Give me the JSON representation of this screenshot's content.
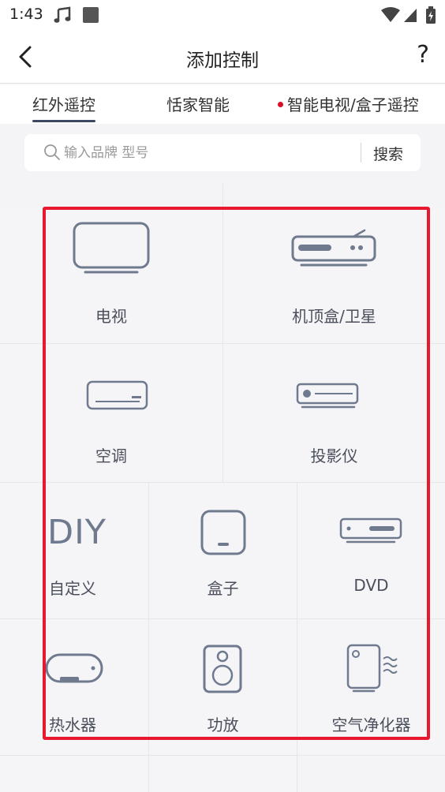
{
  "status_bar": {
    "time": "1:43"
  },
  "header": {
    "title": "添加控制",
    "help": "?"
  },
  "tabs": [
    {
      "label": "红外遥控"
    },
    {
      "label": "恬家智能"
    },
    {
      "label": "智能电视/盒子遥控"
    }
  ],
  "search": {
    "placeholder": "输入品牌 型号",
    "button": "搜索"
  },
  "devices": [
    {
      "label": "电视",
      "icon": "tv-icon"
    },
    {
      "label": "机顶盒/卫星",
      "icon": "set-top-box-icon"
    },
    {
      "label": "空调",
      "icon": "air-conditioner-icon"
    },
    {
      "label": "投影仪",
      "icon": "projector-icon"
    },
    {
      "label": "自定义",
      "icon": "diy-icon",
      "glyph": "DIY"
    },
    {
      "label": "盒子",
      "icon": "box-icon"
    },
    {
      "label": "DVD",
      "icon": "dvd-icon"
    },
    {
      "label": "热水器",
      "icon": "water-heater-icon"
    },
    {
      "label": "功放",
      "icon": "amplifier-icon"
    },
    {
      "label": "空气净化器",
      "icon": "air-purifier-icon"
    }
  ],
  "colors": {
    "icon_stroke": "#6f7a8f",
    "highlight": "#e8192f",
    "tab_dot": "#d8112a"
  }
}
